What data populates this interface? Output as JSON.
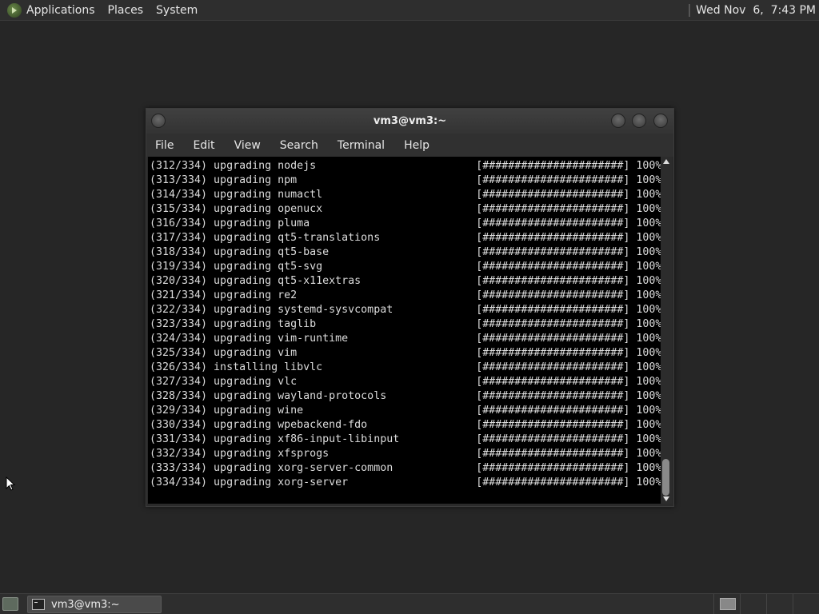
{
  "top_panel": {
    "menus": [
      "Applications",
      "Places",
      "System"
    ],
    "clock": "Wed Nov  6,  7:43 PM"
  },
  "terminal": {
    "title": "vm3@vm3:~",
    "menu": [
      "File",
      "Edit",
      "View",
      "Search",
      "Terminal",
      "Help"
    ],
    "lines": [
      "(312/334) upgrading nodejs                         [######################] 100%",
      "(313/334) upgrading npm                            [######################] 100%",
      "(314/334) upgrading numactl                        [######################] 100%",
      "(315/334) upgrading openucx                        [######################] 100%",
      "(316/334) upgrading pluma                          [######################] 100%",
      "(317/334) upgrading qt5-translations               [######################] 100%",
      "(318/334) upgrading qt5-base                       [######################] 100%",
      "(319/334) upgrading qt5-svg                        [######################] 100%",
      "(320/334) upgrading qt5-x11extras                  [######################] 100%",
      "(321/334) upgrading re2                            [######################] 100%",
      "(322/334) upgrading systemd-sysvcompat             [######################] 100%",
      "(323/334) upgrading taglib                         [######################] 100%",
      "(324/334) upgrading vim-runtime                    [######################] 100%",
      "(325/334) upgrading vim                            [######################] 100%",
      "(326/334) installing libvlc                        [######################] 100%",
      "(327/334) upgrading vlc                            [######################] 100%",
      "(328/334) upgrading wayland-protocols              [######################] 100%",
      "(329/334) upgrading wine                           [######################] 100%",
      "(330/334) upgrading wpebackend-fdo                 [######################] 100%",
      "(331/334) upgrading xf86-input-libinput            [######################] 100%",
      "(332/334) upgrading xfsprogs                       [######################] 100%",
      "(333/334) upgrading xorg-server-common             [######################] 100%",
      "(334/334) upgrading xorg-server                    [######################] 100%"
    ]
  },
  "taskbar": {
    "window_button": "vm3@vm3:~"
  },
  "icons": {
    "menu": "mate-logo-icon",
    "show_desktop": "show-desktop-icon",
    "terminal": "terminal-icon",
    "pointer": "mouse-pointer-icon"
  },
  "colors": {
    "desktop": "#262626",
    "panel": "#2e2e2e",
    "terminal_bg": "#000000",
    "terminal_fg": "#dcdcdc"
  }
}
